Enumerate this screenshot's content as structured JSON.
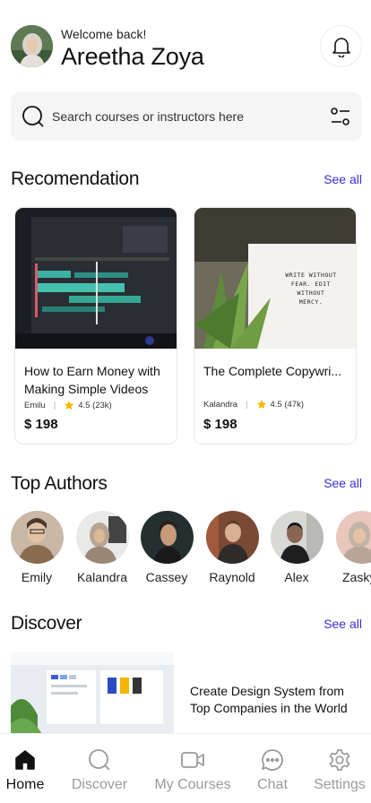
{
  "header": {
    "greeting": "Welcome back!",
    "user_name": "Areetha Zoya"
  },
  "search": {
    "placeholder": "Search courses or instructors here"
  },
  "recommendation": {
    "title": "Recomendation",
    "see_all": "See all",
    "courses": [
      {
        "title": "How to Earn Money with Making Simple Videos",
        "author": "Emilu",
        "rating": "4.5 (23k)",
        "price": "$ 198"
      },
      {
        "title": "The Complete Copywri...",
        "author": "Kalandra",
        "rating": "4.5 (47k)",
        "price": "$ 198",
        "thumb_text": "WRITE WITHOUT FEAR. EDIT WITHOUT MERCY."
      }
    ]
  },
  "top_authors": {
    "title": "Top Authors",
    "see_all": "See all",
    "authors": [
      "Emily",
      "Kalandra",
      "Cassey",
      "Raynold",
      "Alex",
      "Zasky"
    ]
  },
  "discover": {
    "title": "Discover",
    "see_all": "See all",
    "items": [
      {
        "title": "Create Design System from Top Companies in the World"
      }
    ]
  },
  "nav": {
    "items": [
      {
        "label": "Home",
        "icon": "home-icon",
        "active": true
      },
      {
        "label": "Discover",
        "icon": "search-icon",
        "active": false
      },
      {
        "label": "My Courses",
        "icon": "video-icon",
        "active": false
      },
      {
        "label": "Chat",
        "icon": "chat-icon",
        "active": false
      },
      {
        "label": "Settings",
        "icon": "gear-icon",
        "active": false
      }
    ]
  },
  "colors": {
    "accent": "#3a2fd6",
    "star": "#f5b800",
    "search_bg": "#f5f5f5"
  }
}
